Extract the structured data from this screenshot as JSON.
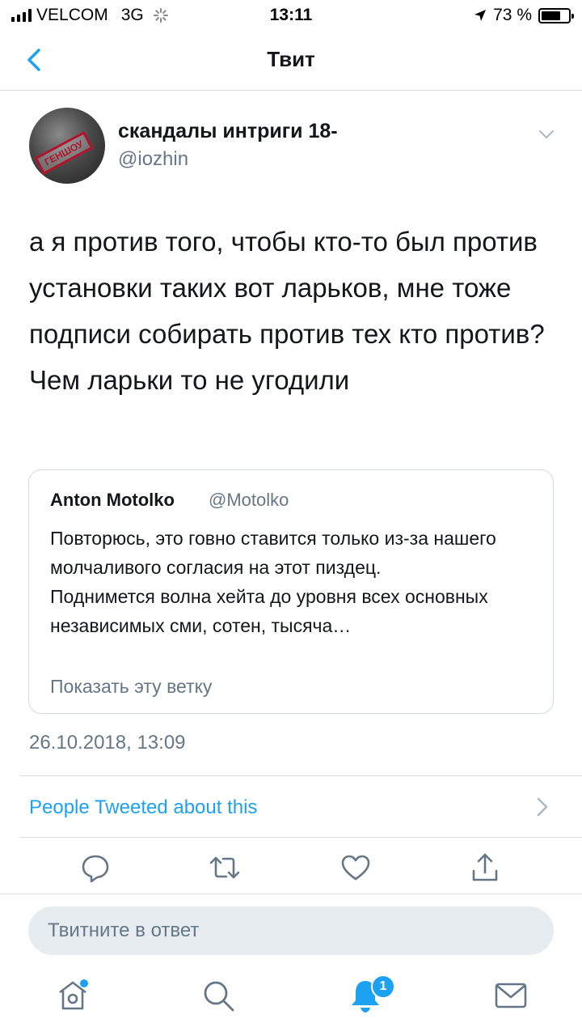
{
  "status_bar": {
    "carrier": "VELCOM",
    "network": "3G",
    "time": "13:11",
    "battery_text": "73 %",
    "battery_level": 0.73
  },
  "nav": {
    "title": "Твит",
    "back_icon": "chevron-left-icon"
  },
  "tweet": {
    "author_name": "скандалы интриги 18-",
    "author_handle": "@iozhin",
    "avatar_stamp": "ГЕНШОУ",
    "text": "а я против того, чтобы кто-то был против установки таких вот ларьков, мне тоже подписи собирать против тех кто против? Чем ларьки то не угодили",
    "timestamp": "26.10.2018, 13:09"
  },
  "quote": {
    "author_name": "Anton Motolko",
    "author_handle": "@Motolko",
    "text": "Повторюсь, это говно ставится только из-за нашего молчаливого согласия на этот пиздец.\nПоднимется волна хейта до уровня всех основных независимых сми, сотен, тысяча…",
    "show_thread": "Показать эту ветку"
  },
  "activity": {
    "label": "People Tweeted about this"
  },
  "actions": [
    "reply-icon",
    "retweet-icon",
    "like-icon",
    "share-icon"
  ],
  "reply": {
    "placeholder": "Твитните в ответ"
  },
  "tab_bar": {
    "tabs": [
      "home-icon",
      "search-icon",
      "notifications-icon",
      "messages-icon"
    ],
    "notification_count": "1"
  },
  "colors": {
    "accent": "#1da1f2",
    "secondary_text": "#657786",
    "input_bg": "#e6ecf0"
  }
}
